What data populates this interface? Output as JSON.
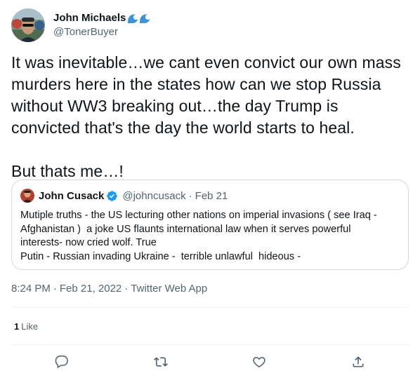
{
  "author": {
    "display_name": "John Michaels",
    "name_emoji_icons": [
      "water-wave-icon",
      "water-wave-icon"
    ],
    "handle": "@TonerBuyer",
    "avatar_icon": "avatar-photo-icon"
  },
  "tweet": {
    "text": "It was inevitable…we cant even convict our own mass\nmurders here in the states how can we stop Russia\nwithout WW3 breaking out…the day Trump is\nconvicted that's the day the world starts to heal.\n\nBut thats me…!"
  },
  "quote": {
    "display_name": "John Cusack",
    "verified_icon": "verified-badge-icon",
    "handle": "@johncusack",
    "separator": "·",
    "date": "Feb 21",
    "text": "Mutiple truths - the US lecturing other nations on imperial invasions ( see Iraq -\nAfghanistan )  a joke US flaunts international law when it serves powerful\ninterests- now cried wolf. True\nPutin - Russian invading Ukraine -  terrible unlawful  hideous -"
  },
  "meta": {
    "time": "8:24 PM",
    "separator": "·",
    "date": "Feb 21, 2022",
    "source": "Twitter Web App"
  },
  "stats": {
    "likes_count": "1",
    "likes_label": "Like"
  },
  "actions": [
    {
      "name": "reply",
      "icon": "reply-bubble-icon"
    },
    {
      "name": "retweet",
      "icon": "retweet-icon"
    },
    {
      "name": "like",
      "icon": "heart-icon"
    },
    {
      "name": "share",
      "icon": "share-upload-icon"
    }
  ],
  "colors": {
    "text_primary": "#0f1419",
    "text_secondary": "#536471",
    "border": "#cfd9de",
    "divider": "#eff3f4",
    "verified_blue": "#1d9bf0",
    "wave_blue": "#3b94d9"
  }
}
